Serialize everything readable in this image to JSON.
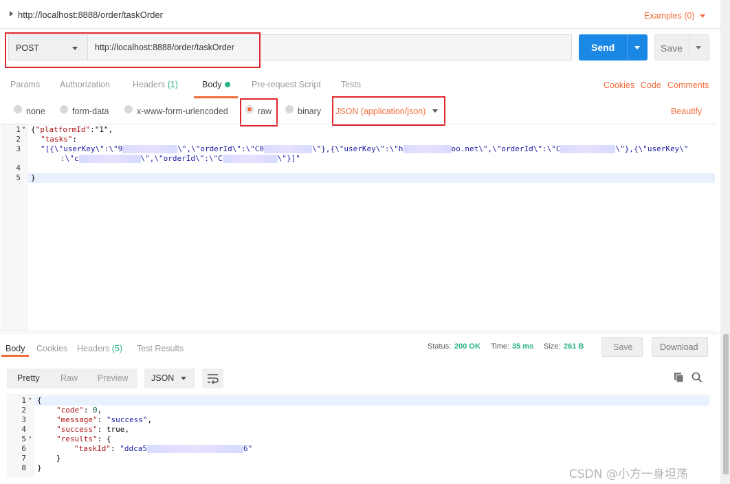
{
  "request": {
    "title": "http://localhost:8888/order/taskOrder",
    "examples_label": "Examples (0)",
    "method": "POST",
    "url": "http://localhost:8888/order/taskOrder",
    "send_label": "Send",
    "save_label": "Save"
  },
  "request_tabs": [
    {
      "label": "Params"
    },
    {
      "label": "Authorization"
    },
    {
      "label": "Headers",
      "count": "(1)"
    },
    {
      "label": "Body"
    },
    {
      "label": "Pre-request Script"
    },
    {
      "label": "Tests"
    }
  ],
  "request_links": [
    "Cookies",
    "Code",
    "Comments"
  ],
  "body_types": [
    "none",
    "form-data",
    "x-www-form-urlencoded",
    "raw",
    "binary"
  ],
  "selected_body_type": "raw",
  "content_type": "JSON (application/json)",
  "beautify_label": "Beautify",
  "request_code": {
    "line_numbers": [
      "1",
      "2",
      "3",
      "",
      "4",
      "5"
    ],
    "line1_open": "{",
    "line1_key": "\"platformId\"",
    "line1_rest": ":\"1\",",
    "line2_key": "\"tasks\"",
    "line2_rest": ":",
    "line3_a": "\"[{\\\"userKey\\\":\\\"9",
    "line3_b": "\\\",\\\"orderId\\\":\\\"C0",
    "line3_c": "\\\"},{\\\"userKey\\\":\\\"h",
    "line3_d": "oo.net\\\",\\\"orderId\\\":\\\"C",
    "line3_e": "\\\"},{\\\"userKey\\\"",
    "line3w_a": ":\\\"c",
    "line3w_b": "\\\",\\\"orderId\\\":\\\"C",
    "line3w_c": "\\\"}]\"",
    "line5": "}"
  },
  "response": {
    "tabs": [
      {
        "label": "Body"
      },
      {
        "label": "Cookies"
      },
      {
        "label": "Headers",
        "count": "(5)"
      },
      {
        "label": "Test Results"
      }
    ],
    "status_label": "Status:",
    "status_value": "200 OK",
    "time_label": "Time:",
    "time_value": "35 ms",
    "size_label": "Size:",
    "size_value": "261 B",
    "save_label": "Save",
    "download_label": "Download",
    "view_modes": [
      "Pretty",
      "Raw",
      "Preview"
    ],
    "format": "JSON",
    "line_numbers": [
      "1",
      "2",
      "3",
      "4",
      "5",
      "6",
      "7",
      "8"
    ],
    "code": {
      "l1": "{",
      "l2_key": "\"code\"",
      "l2_val": "0",
      "l3_key": "\"message\"",
      "l3_val": "\"success\"",
      "l4_key": "\"success\"",
      "l4_val": "true",
      "l5_key": "\"results\"",
      "l5_rest": ": {",
      "l6_key": "\"taskId\"",
      "l6_val_a": "\"ddca5",
      "l6_val_b": "6\"",
      "l7": "}",
      "l8": "}"
    }
  },
  "watermark": "CSDN @小方一身坦荡",
  "colors": {
    "accent": "#f26b3a",
    "send": "#1c88e5",
    "success": "#26b47f",
    "highlight": "#e0252d"
  },
  "icons": [
    "chevron-right-icon",
    "chevron-down-icon",
    "wrap-lines-icon",
    "copy-icon",
    "search-icon"
  ]
}
